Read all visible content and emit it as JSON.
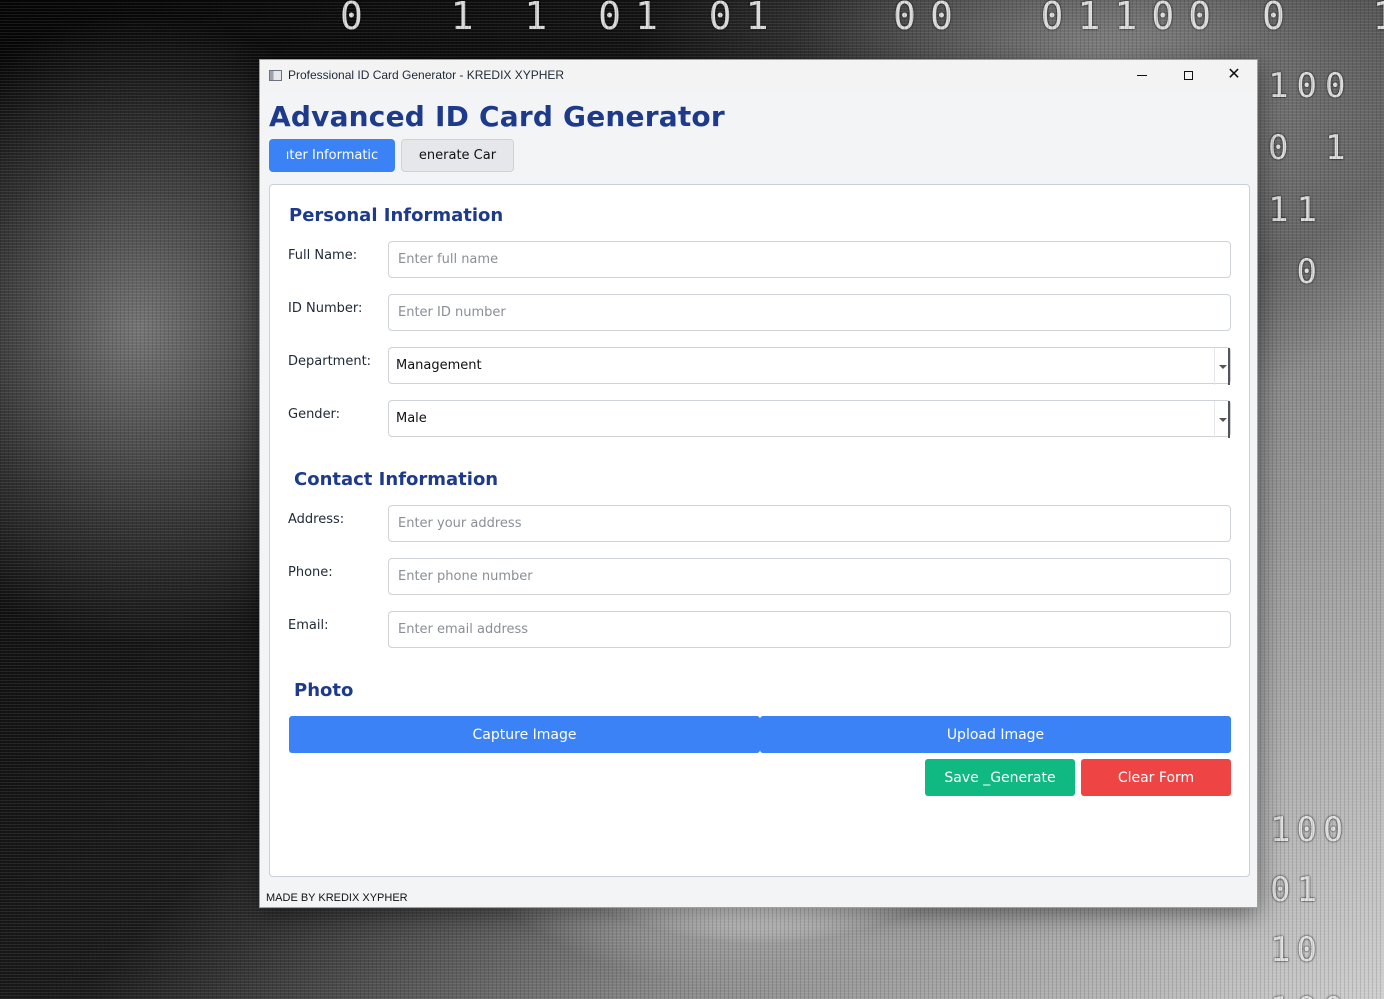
{
  "desktop": {
    "top_digits": "0  1 1 01 01   00  01100 0  1   10",
    "right_digits": "100\n0 1\n11\n 0",
    "bottom_right_digits": "100\n01\n10\n100"
  },
  "window": {
    "title": "Professional ID Card Generator - KREDIX XYPHER",
    "controls": {
      "minimize": "minimize-icon",
      "maximize": "maximize-icon",
      "close": "close-icon"
    }
  },
  "app": {
    "heading": "Advanced ID Card Generator",
    "tabs": [
      {
        "label": "ıter Informatic",
        "active": true
      },
      {
        "label": "enerate Car",
        "active": false
      }
    ],
    "personal": {
      "title": "Personal Information",
      "full_name": {
        "label": "Full Name:",
        "placeholder": "Enter full name",
        "value": ""
      },
      "id_number": {
        "label": "ID Number:",
        "placeholder": "Enter ID number",
        "value": ""
      },
      "department": {
        "label": "Department:",
        "value": "Management"
      },
      "gender": {
        "label": "Gender:",
        "value": "Male"
      }
    },
    "contact": {
      "title": "Contact Information",
      "address": {
        "label": "Address:",
        "placeholder": "Enter your address",
        "value": ""
      },
      "phone": {
        "label": "Phone:",
        "placeholder": "Enter phone number",
        "value": ""
      },
      "email": {
        "label": "Email:",
        "placeholder": "Enter email address",
        "value": ""
      }
    },
    "photo": {
      "title": "Photo",
      "capture_label": "Capture Image",
      "upload_label": "Upload Image"
    },
    "actions": {
      "save_label": "Save _Generate",
      "clear_label": "Clear Form"
    },
    "footer": "MADE BY KREDIX XYPHER",
    "colors": {
      "heading": "#1e3a8a",
      "primary": "#3b82f6",
      "save": "#10b981",
      "clear": "#ef4444"
    }
  }
}
